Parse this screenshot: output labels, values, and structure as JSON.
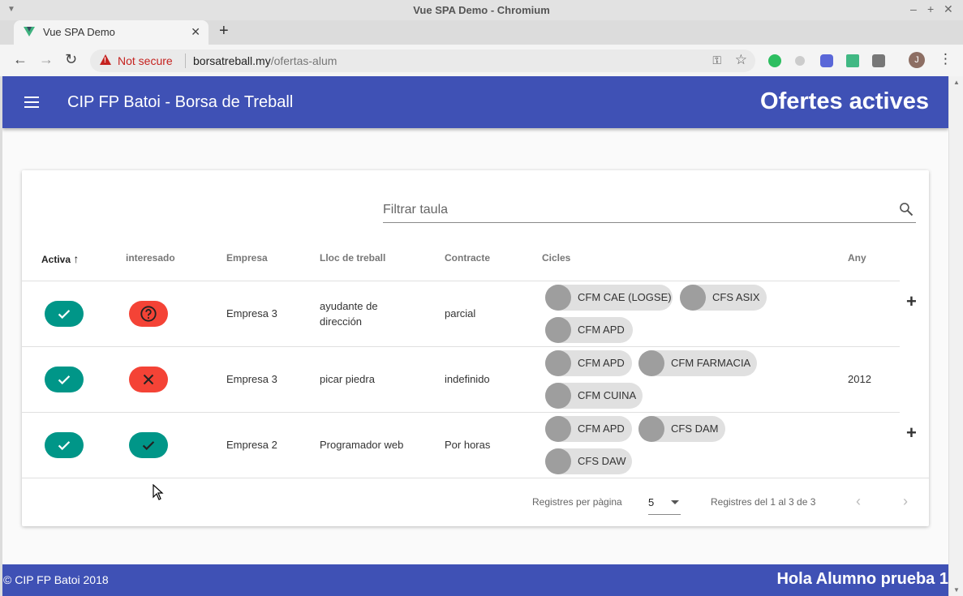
{
  "window": {
    "title": "Vue SPA Demo - Chromium"
  },
  "tab": {
    "title": "Vue SPA Demo",
    "close": "✕",
    "new": "+"
  },
  "toolbar": {
    "back": "←",
    "forward": "→",
    "reload": "↻",
    "security": "Not secure",
    "url_host": "borsatreball.my",
    "url_path": "/ofertas-alum",
    "avatar_letter": "J"
  },
  "appbar": {
    "title": "CIP FP Batoi - Borsa de Treball",
    "page_title": "Ofertes actives"
  },
  "search": {
    "placeholder": "Filtrar taula"
  },
  "table": {
    "headers": [
      "Activa",
      "interesado",
      "Empresa",
      "Lloc de treball",
      "Contracte",
      "Cicles",
      "Any"
    ],
    "rows": [
      {
        "activa": "yes",
        "interesado": "unknown",
        "empresa": "Empresa 3",
        "lloc": "ayudante de dirección",
        "contracte": "parcial",
        "cicles": [
          "CFM CAE (LOGSE)",
          "CFS ASIX",
          "CFM APD"
        ],
        "any": "",
        "expand": "+"
      },
      {
        "activa": "yes",
        "interesado": "no",
        "empresa": "Empresa 3",
        "lloc": "picar piedra",
        "contracte": "indefinido",
        "cicles": [
          "CFM APD",
          "CFM FARMACIA",
          "CFM CUINA"
        ],
        "any": "2012",
        "expand": ""
      },
      {
        "activa": "yes",
        "interesado": "yes",
        "empresa": "Empresa 2",
        "lloc": "Programador web",
        "contracte": "Por horas",
        "cicles": [
          "CFM APD",
          "CFS DAM",
          "CFS DAW"
        ],
        "any": "",
        "expand": "+"
      }
    ]
  },
  "pagination": {
    "per_page_label": "Registres per pàgina",
    "per_page_value": "5",
    "range_text": "Registres del 1 al 3 de 3",
    "prev": "‹",
    "next": "›"
  },
  "footer": {
    "copyright": "© CIP FP Batoi 2018",
    "greeting": "Hola Alumno prueba 1"
  },
  "colors": {
    "primary": "#3f51b5",
    "teal": "#009688",
    "red": "#f44336",
    "chip": "#e0e0e0",
    "chip_avatar": "#9e9e9e"
  }
}
